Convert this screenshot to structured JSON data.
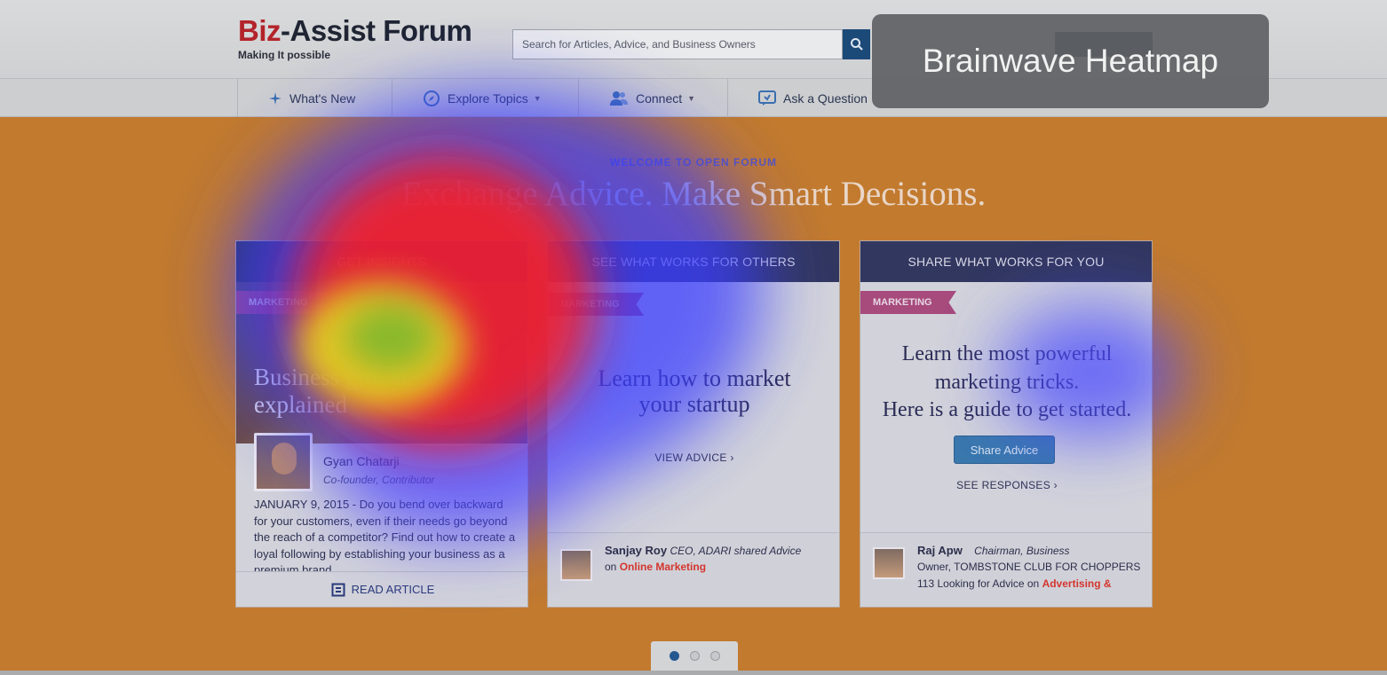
{
  "header": {
    "brand_prefix": "Biz",
    "brand_suffix": "-Assist Forum",
    "tagline": "Making It possible",
    "search_placeholder": "Search for Articles, Advice, and Business Owners"
  },
  "nav": {
    "items": [
      {
        "label": "What's New",
        "icon": "sparkle-icon"
      },
      {
        "label": "Explore Topics",
        "icon": "compass-icon"
      },
      {
        "label": "Connect",
        "icon": "people-icon"
      },
      {
        "label": "Ask a Question",
        "icon": "question-icon"
      }
    ]
  },
  "hero": {
    "eyebrow": "WELCOME TO OPEN FORUM",
    "headline": "Exchange Advice. Make Smart Decisions."
  },
  "cards": [
    {
      "header": "GET INSIGHTS",
      "tag": "MARKETING",
      "title": "Business growth explained",
      "author_name": "Gyan Chatarji",
      "author_role": "Co-founder, Contributor",
      "excerpt": "JANUARY 9, 2015 - Do you bend over backward for your customers, even if their needs go beyond the reach of a competitor? Find out how to create a loyal following by establishing your business as a premium brand.",
      "footer_link": "READ ARTICLE"
    },
    {
      "header": "SEE WHAT WORKS FOR OTHERS",
      "tag": "MARKETING",
      "title_line1": "Learn how to market",
      "title_line2": "your startup",
      "link": "VIEW ADVICE ›",
      "footer_name": "Sanjay Roy",
      "footer_role": "CEO, ADARI shared Advice",
      "footer_on": "on",
      "footer_topic": "Online Marketing"
    },
    {
      "header": "SHARE WHAT WORKS FOR YOU",
      "tag": "MARKETING",
      "title_line1": "Learn the most powerful",
      "title_line2": "marketing tricks.",
      "title_line3": "Here is a guide to get started.",
      "button": "Share Advice",
      "link": "SEE RESPONSES ›",
      "footer_name": "Raj Apw",
      "footer_role": "Chairman, Business",
      "footer_line2": "Owner, TOMBSTONE CLUB FOR CHOPPERS",
      "footer_line3": "113 Looking for Advice on",
      "footer_topic": "Advertising &"
    }
  ],
  "carousel": {
    "active_index": 0,
    "count": 3
  },
  "overlay": {
    "label": "Brainwave Heatmap"
  },
  "colors": {
    "hero_bg": "#c27a2e",
    "card_header": "#323760",
    "tag": "#a74a7c",
    "accent_red": "#d4352e",
    "button_blue": "#3a78ad"
  }
}
